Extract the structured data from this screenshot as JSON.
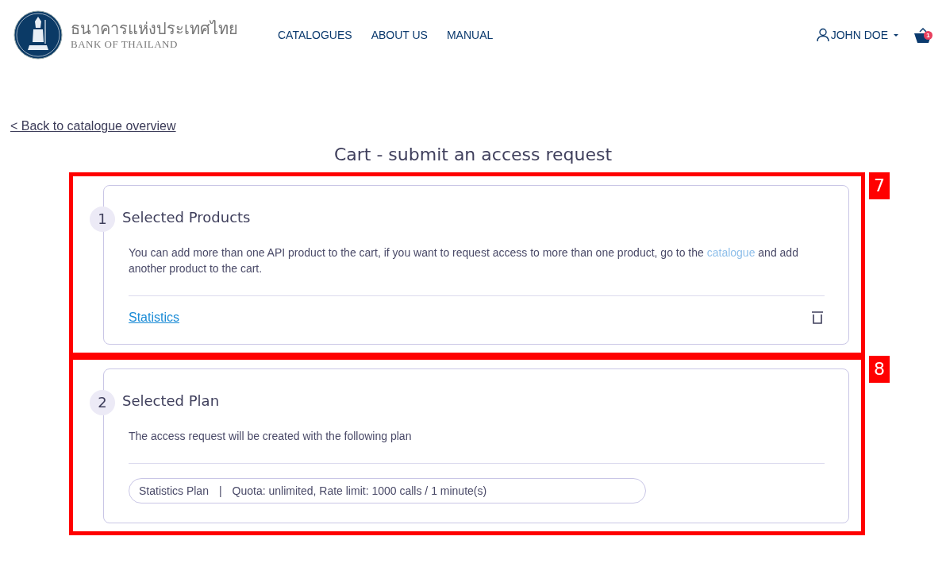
{
  "header": {
    "logo_thai": "ธนาคารแห่งประเทศไทย",
    "logo_english": "BANK OF THAILAND",
    "nav": [
      {
        "label": "CATALOGUES"
      },
      {
        "label": "ABOUT US"
      },
      {
        "label": "MANUAL"
      }
    ],
    "user": {
      "name": "JOHN DOE"
    },
    "cart": {
      "count": "1"
    }
  },
  "back_link": "< Back to catalogue overview",
  "page_title": "Cart - submit an access request",
  "sections": [
    {
      "kind": "products",
      "callout": "7",
      "step": "1",
      "title": "Selected Products",
      "text_before": "You can add more than one API product to the cart, if you want to request access to more than one product, go to the ",
      "link": "catalogue",
      "text_after": " and add another product to the cart.",
      "products": [
        {
          "name": "Statistics"
        }
      ]
    },
    {
      "kind": "plan",
      "callout": "8",
      "step": "2",
      "title": "Selected Plan",
      "text_before": "The access request will be created with the following plan",
      "plan": {
        "name": "Statistics Plan",
        "separator": "|",
        "details": "Quota: unlimited, Rate limit: 1000 calls / 1 minute(s)"
      }
    }
  ]
}
